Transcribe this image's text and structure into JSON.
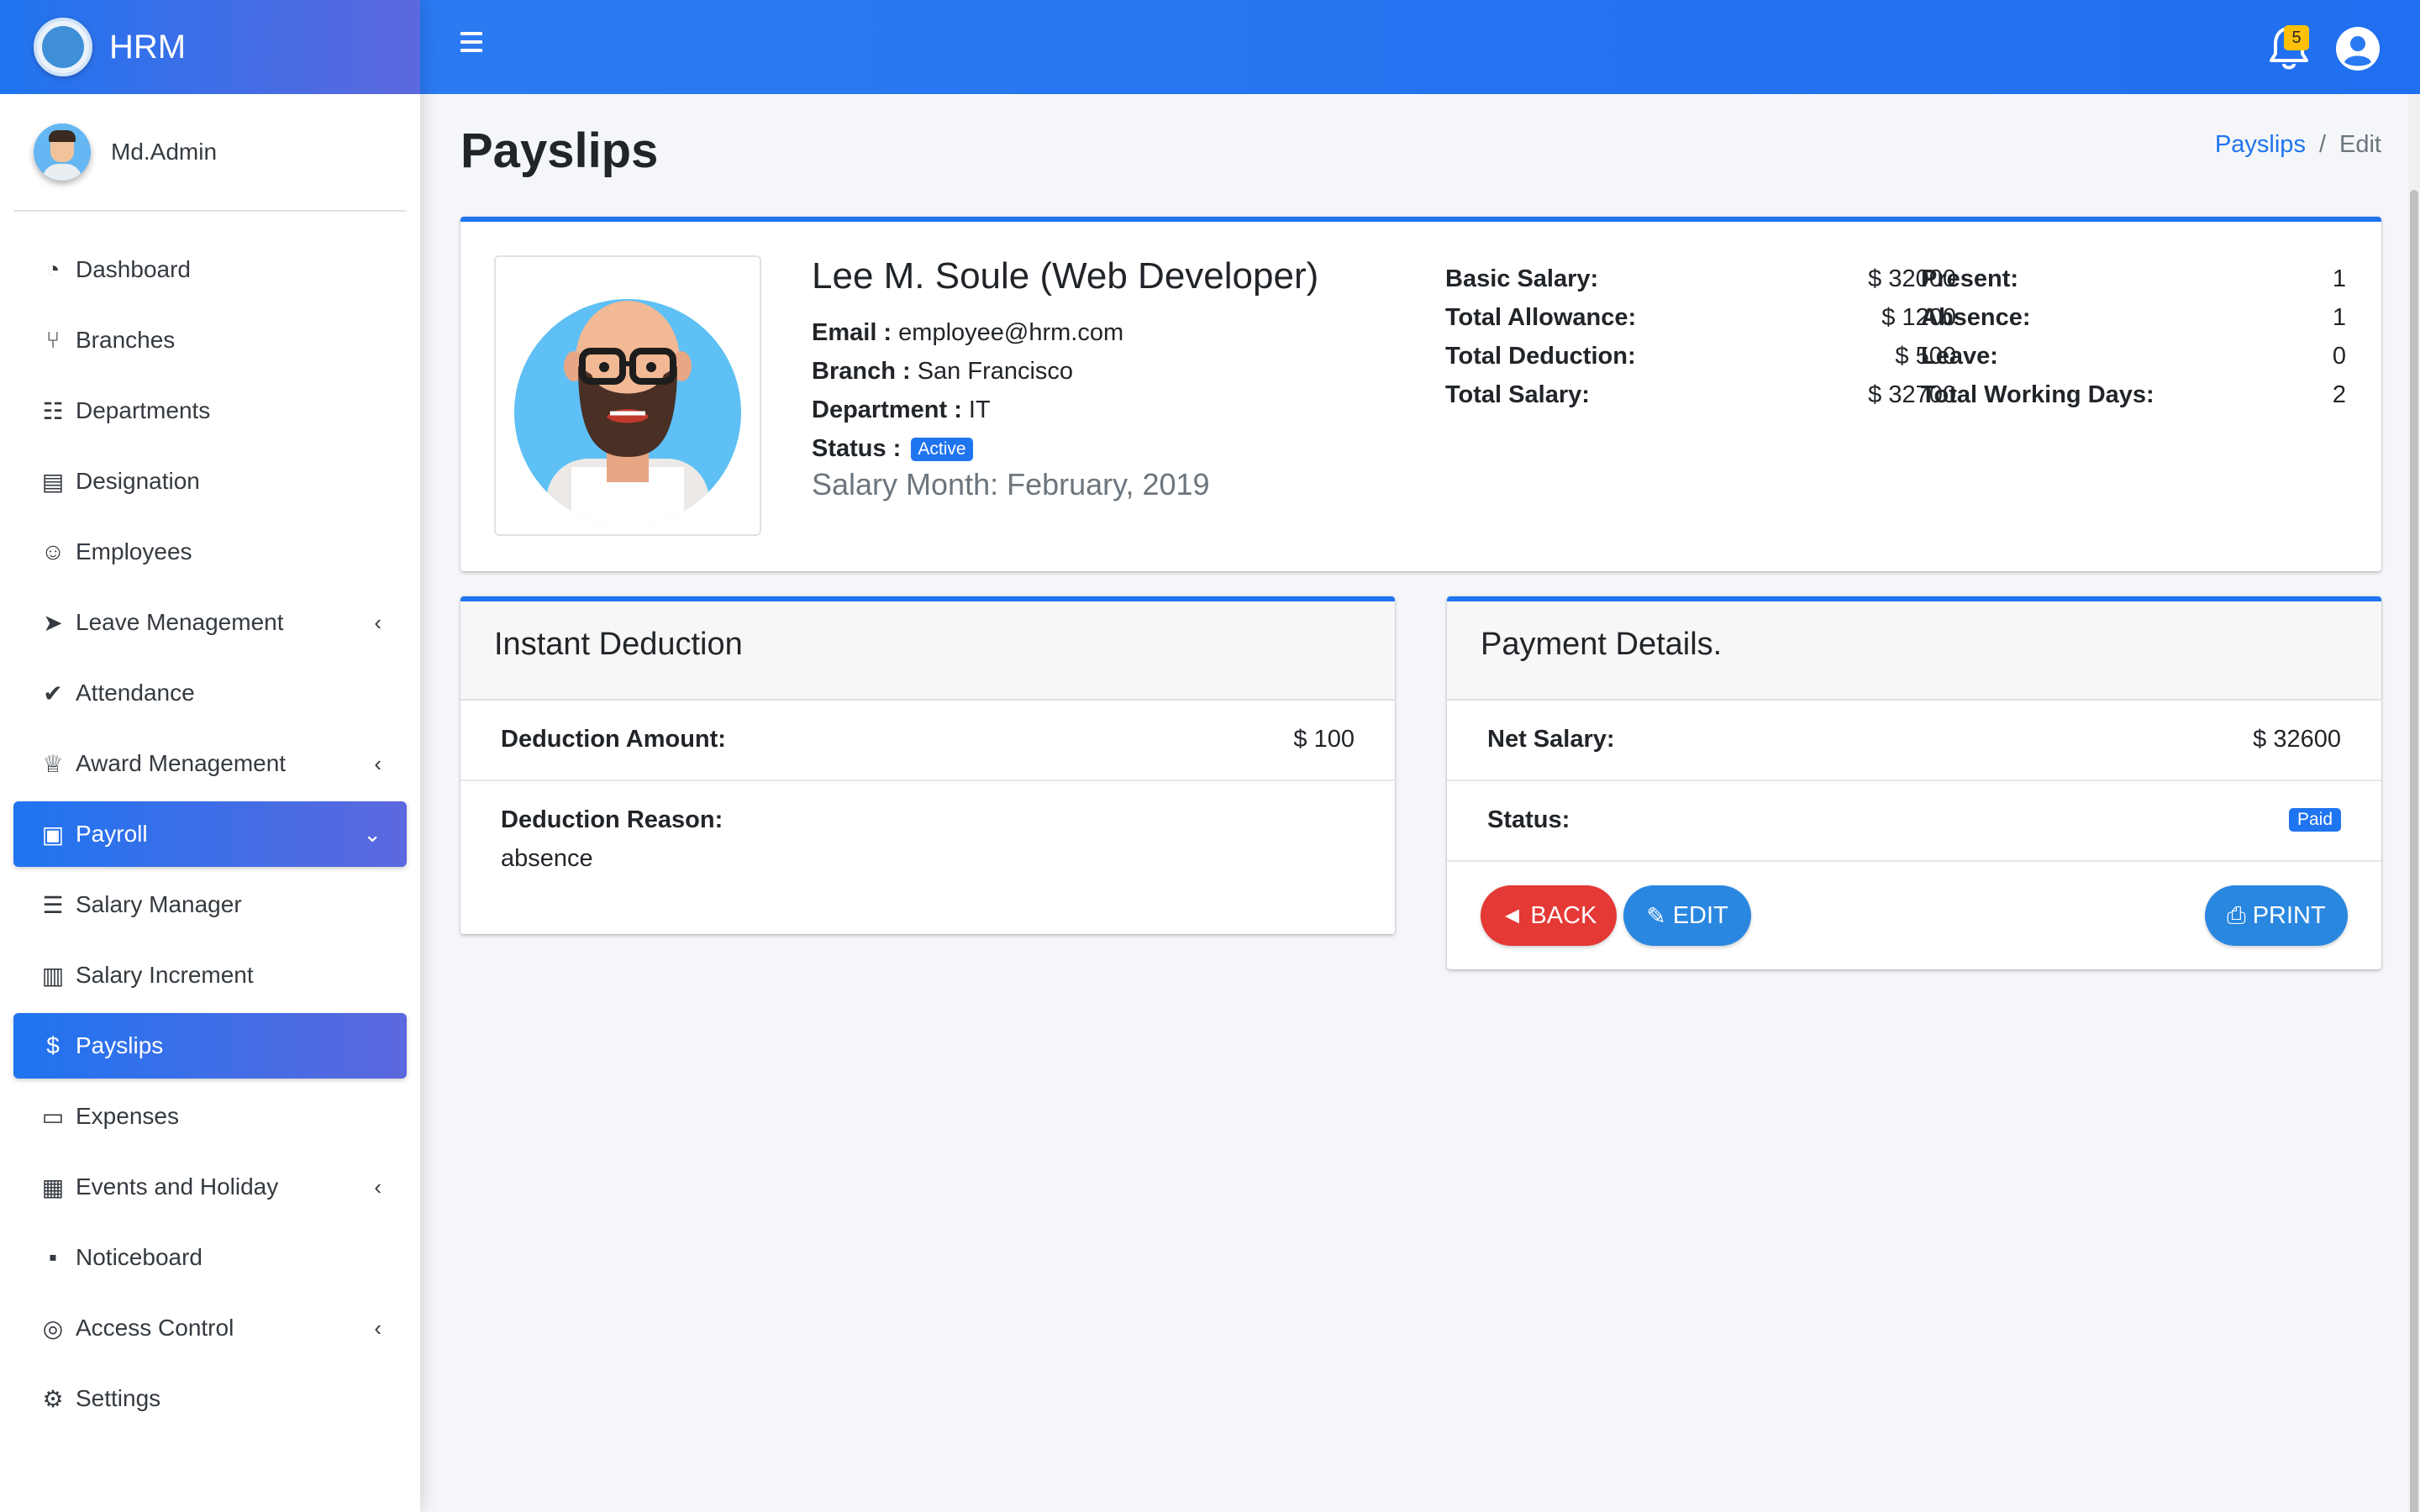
{
  "brand": {
    "name": "HRM"
  },
  "user": {
    "name": "Md.Admin"
  },
  "colors": {
    "primary": "#1f74f0",
    "danger": "#e53935",
    "warning": "#ffc107",
    "sidebar_bg": "#ffffff",
    "content_bg": "#f4f6f9"
  },
  "sidebar": {
    "items": [
      {
        "label": "Dashboard",
        "icon": "dashboard-icon"
      },
      {
        "label": "Branches",
        "icon": "branch-icon"
      },
      {
        "label": "Departments",
        "icon": "sitemap-icon"
      },
      {
        "label": "Designation",
        "icon": "id-card-icon"
      },
      {
        "label": "Employees",
        "icon": "user-tie-icon"
      },
      {
        "label": "Leave Menagement",
        "icon": "rocket-icon",
        "has_chevron": true
      },
      {
        "label": "Attendance",
        "icon": "user-check-icon"
      },
      {
        "label": "Award Menagement",
        "icon": "trophy-icon",
        "has_chevron": true
      },
      {
        "label": "Payroll",
        "icon": "money-icon",
        "active": true,
        "expanded": true
      },
      {
        "label": "Salary Manager",
        "icon": "bars-icon"
      },
      {
        "label": "Salary Increment",
        "icon": "file-invoice-icon"
      },
      {
        "label": "Payslips",
        "icon": "hand-dollar-icon",
        "active": true
      },
      {
        "label": "Expenses",
        "icon": "credit-card-icon"
      },
      {
        "label": "Events and Holiday",
        "icon": "calendar-check-icon",
        "has_chevron": true
      },
      {
        "label": "Noticeboard",
        "icon": "sticky-note-icon"
      },
      {
        "label": "Access Control",
        "icon": "fingerprint-icon",
        "has_chevron": true
      },
      {
        "label": "Settings",
        "icon": "gear-icon"
      }
    ]
  },
  "topbar": {
    "notification_count": "5"
  },
  "page": {
    "title": "Payslips",
    "breadcrumb": {
      "parent": "Payslips",
      "separator": "/",
      "current": "Edit"
    }
  },
  "employee": {
    "name": "Lee M. Soule (Web Developer)",
    "email_label": "Email :",
    "email": "employee@hrm.com",
    "branch_label": "Branch :",
    "branch": "San Francisco",
    "department_label": "Department :",
    "department": "IT",
    "status_label": "Status :",
    "status": "Active",
    "salary_month": "Salary Month: February, 2019"
  },
  "salary_stats": [
    {
      "label": "Basic Salary:",
      "value": "$ 32000"
    },
    {
      "label": "Total Allowance:",
      "value": "$ 1200"
    },
    {
      "label": "Total Deduction:",
      "value": "$ 500"
    },
    {
      "label": "Total Salary:",
      "value": "$ 32700"
    }
  ],
  "attendance_stats": [
    {
      "label": "Present:",
      "value": "1"
    },
    {
      "label": "Absence:",
      "value": "1"
    },
    {
      "label": "Leave:",
      "value": "0"
    },
    {
      "label": "Total Working Days:",
      "value": "2"
    }
  ],
  "deduction": {
    "title": "Instant Deduction",
    "amount_label": "Deduction Amount:",
    "amount": "$ 100",
    "reason_label": "Deduction Reason:",
    "reason": "absence"
  },
  "payment": {
    "title": "Payment Details.",
    "net_label": "Net Salary:",
    "net": "$ 32600",
    "status_label": "Status:",
    "status": "Paid"
  },
  "buttons": {
    "back": "BACK",
    "edit": "EDIT",
    "print": "PRINT"
  }
}
